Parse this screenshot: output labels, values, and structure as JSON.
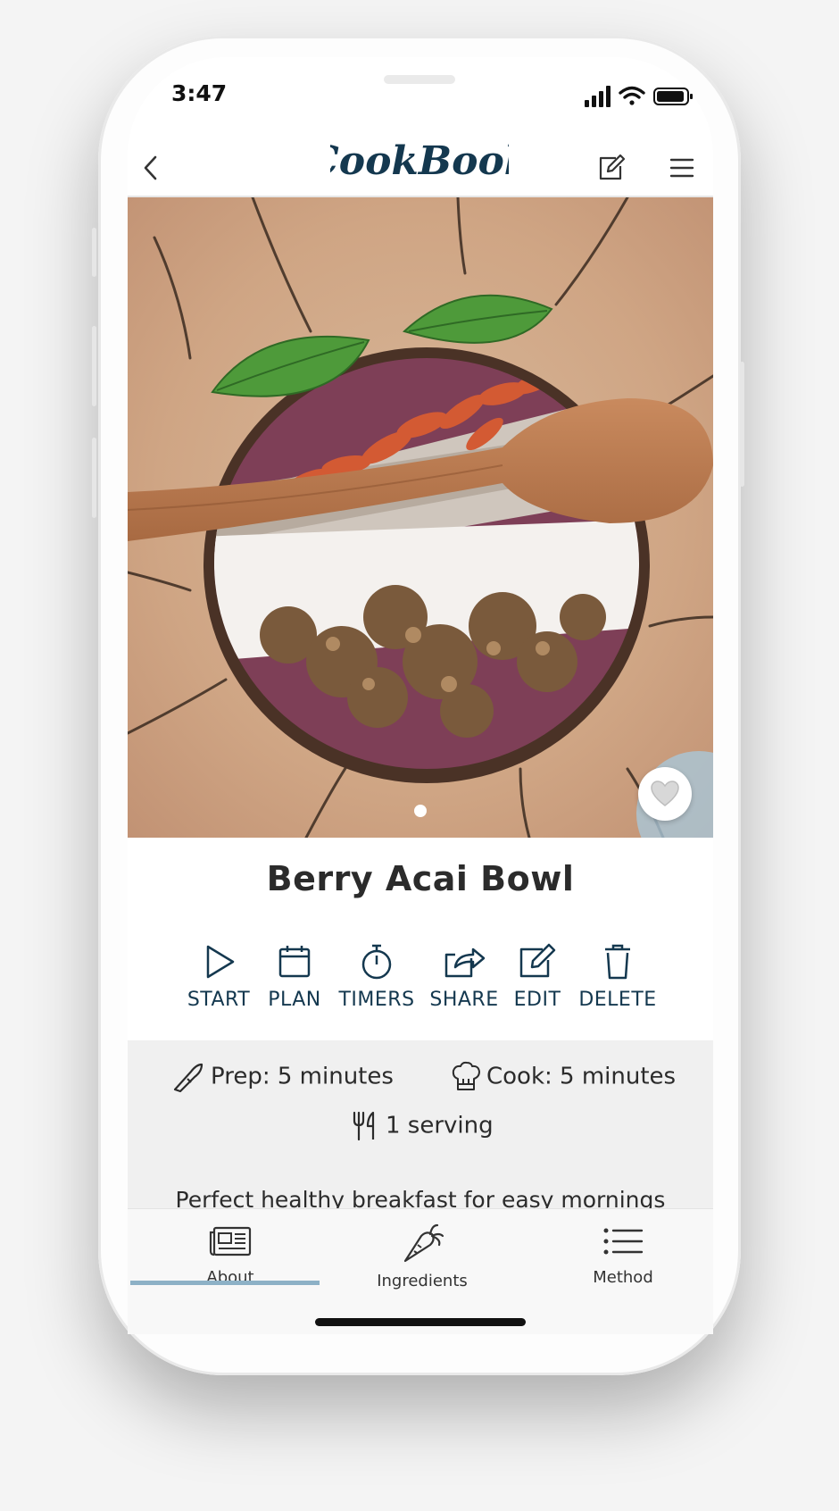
{
  "status_bar": {
    "time": "3:47"
  },
  "header": {
    "logo_text": "CookBook",
    "back_icon": "chevron-left-icon",
    "edit_icon": "edit-icon",
    "menu_icon": "hamburger-menu-icon"
  },
  "hero": {
    "slide_count": 1,
    "active_slide": 1,
    "favorite_icon": "heart-icon"
  },
  "recipe": {
    "title": "Berry Acai Bowl",
    "prep": "Prep: 5 minutes",
    "cook": "Cook: 5 minutes",
    "servings": "1 serving",
    "description": "Perfect healthy breakfast for easy mornings"
  },
  "actions": [
    {
      "label": "START",
      "icon": "play-icon"
    },
    {
      "label": "PLAN",
      "icon": "calendar-icon"
    },
    {
      "label": "TIMERS",
      "icon": "stopwatch-icon"
    },
    {
      "label": "SHARE",
      "icon": "share-icon"
    },
    {
      "label": "EDIT",
      "icon": "edit-icon"
    },
    {
      "label": "DELETE",
      "icon": "trash-icon"
    }
  ],
  "tabs": [
    {
      "label": "About",
      "icon": "newspaper-icon",
      "active": true
    },
    {
      "label": "Ingredients",
      "icon": "carrot-icon",
      "active": false
    },
    {
      "label": "Method",
      "icon": "list-icon",
      "active": false
    }
  ],
  "colors": {
    "accent": "#14384f",
    "tab_indicator": "#8db1c6",
    "panel": "#f0f0f0"
  }
}
